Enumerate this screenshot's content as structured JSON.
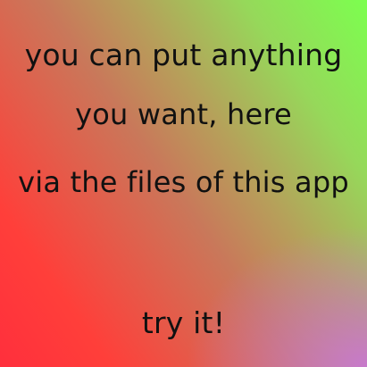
{
  "lines": [
    "you can put anything",
    "you want, here",
    "via the files of this app",
    "try it!"
  ]
}
